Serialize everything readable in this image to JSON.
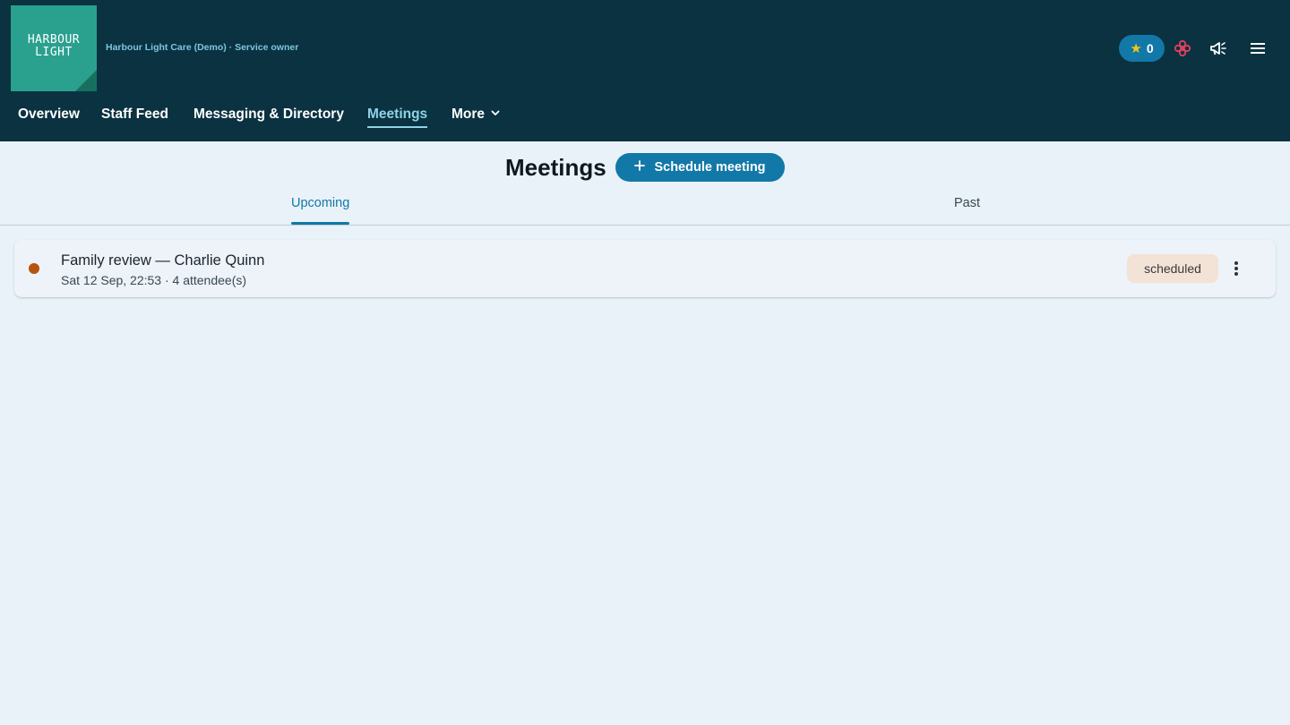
{
  "header": {
    "logo_text": "HARBOUR\nLIGHT",
    "org_label": "Harbour Light Care (Demo) · Service owner",
    "star_count": "0",
    "icons": [
      "star-icon",
      "care-flower-icon",
      "announcement-icon",
      "menu-icon"
    ]
  },
  "nav": {
    "items": [
      {
        "label": "Overview"
      },
      {
        "label": "Staff Feed"
      },
      {
        "label": "Messaging & Directory"
      },
      {
        "label": "Meetings",
        "active": true
      },
      {
        "label": "More"
      }
    ]
  },
  "page": {
    "title": "Meetings",
    "schedule_button": "Schedule meeting"
  },
  "tabs": [
    {
      "label": "Upcoming",
      "active": true
    },
    {
      "label": "Past"
    }
  ],
  "meetings": [
    {
      "title": "Family review — Charlie Quinn",
      "subtitle": "Sat 12 Sep, 22:53 · 4 attendee(s)",
      "status": "scheduled",
      "status_color": "#b5540f"
    }
  ],
  "colors": {
    "header_bg": "#0a3241",
    "accent": "#1278a8",
    "logo": "#2aa08f",
    "page_bg": "#e8f2f8"
  }
}
